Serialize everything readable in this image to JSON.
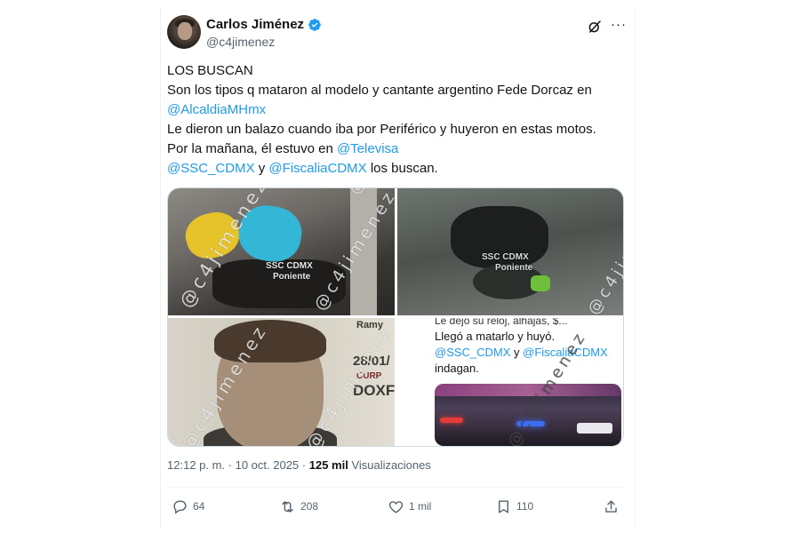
{
  "author": {
    "display_name": "Carlos Jiménez",
    "handle": "@c4jimenez",
    "verified": true,
    "avatar_icon": "avatar-photo"
  },
  "header": {
    "grok_icon": "grok-icon",
    "more_icon": "more-icon",
    "more_label": "···"
  },
  "tweet": {
    "line1": "LOS BUSCAN",
    "line2": "Son los tipos q mataron al modelo y cantante argentino Fede Dorcaz en",
    "mention1": "@AlcaldiaMHmx",
    "line4": "Le dieron un balazo cuando iba por Periférico y huyeron en estas motos.",
    "line5_prefix": "Por la mañana, él estuvo en ",
    "mention2": "@Televisa",
    "mention3": "@SSC_CDMX",
    "line6_mid": " y ",
    "mention4": "@FiscaliaCDMX",
    "line6_suffix": " los buscan."
  },
  "media": {
    "watermark": "@c4jimenez",
    "tile1": {
      "caption1": "SSC CDMX",
      "caption2": "Poniente"
    },
    "tile2": {
      "caption1": "SSC CDMX",
      "caption2": "Poniente"
    },
    "tile3": {
      "doc1": "Ramy",
      "doc2": "28/01/",
      "doc3": "CURP",
      "doc4": "DOXF"
    },
    "tile4": {
      "cut_line": "Le dejó su reloj, alhajas, $...",
      "line1": "Llegó a matarlo y huyó.",
      "mention_a": "@SSC_CDMX",
      "mid": " y ",
      "mention_b": "@FiscaliaCDMX",
      "line3": "indagan."
    }
  },
  "meta": {
    "time": "12:12 p. m.",
    "sep1": " · ",
    "date": "10 oct. 2025",
    "sep2": " · ",
    "views_count": "125 mil",
    "views_label": " Visualizaciones"
  },
  "actions": {
    "reply_count": "64",
    "repost_count": "208",
    "like_count": "1 mil",
    "bookmark_count": "110"
  },
  "colors": {
    "accent": "#1d9bf0",
    "text": "#0f1419",
    "muted": "#536471"
  }
}
